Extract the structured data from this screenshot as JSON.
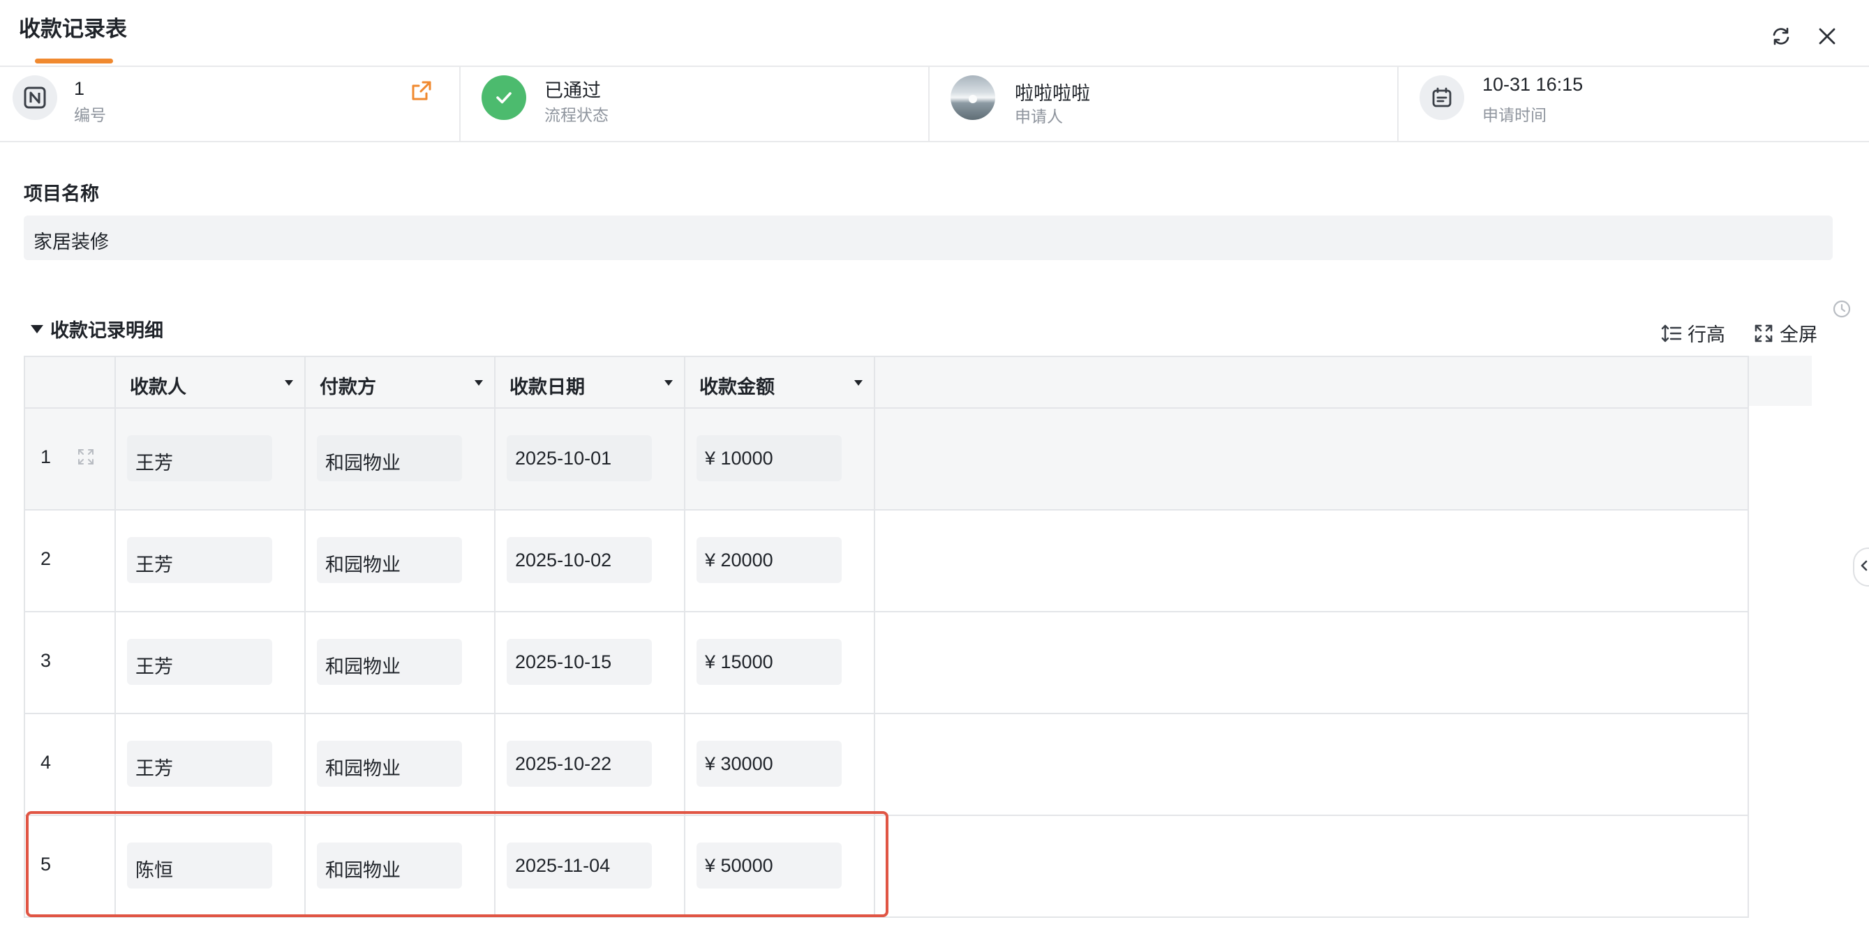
{
  "header": {
    "title": "收款记录表"
  },
  "info": {
    "number": {
      "value": "1",
      "label": "编号"
    },
    "status": {
      "value": "已通过",
      "label": "流程状态"
    },
    "applicant": {
      "value": "啦啦啦啦",
      "label": "申请人"
    },
    "time": {
      "value": "10-31 16:15",
      "label": "申请时间"
    }
  },
  "project": {
    "label": "项目名称",
    "value": "家居装修"
  },
  "detail": {
    "title": "收款记录明细",
    "row_height_label": "行高",
    "fullscreen_label": "全屏"
  },
  "table": {
    "columns": [
      "收款人",
      "付款方",
      "收款日期",
      "收款金额"
    ],
    "rows": [
      {
        "num": "1",
        "payee": "王芳",
        "payer": "和园物业",
        "date": "2025-10-01",
        "amount": "¥ 10000"
      },
      {
        "num": "2",
        "payee": "王芳",
        "payer": "和园物业",
        "date": "2025-10-02",
        "amount": "¥ 20000"
      },
      {
        "num": "3",
        "payee": "王芳",
        "payer": "和园物业",
        "date": "2025-10-15",
        "amount": "¥ 15000"
      },
      {
        "num": "4",
        "payee": "王芳",
        "payer": "和园物业",
        "date": "2025-10-22",
        "amount": "¥ 30000"
      },
      {
        "num": "5",
        "payee": "陈恒",
        "payer": "和园物业",
        "date": "2025-11-04",
        "amount": "¥ 50000"
      }
    ]
  },
  "colors": {
    "accent": "#f0892f",
    "status_green": "#4cbb6e",
    "highlight_red": "#e05544"
  }
}
